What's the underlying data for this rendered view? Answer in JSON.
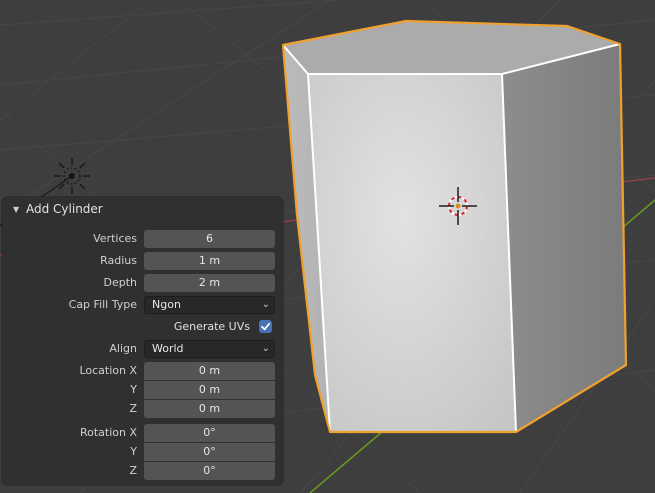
{
  "panel": {
    "title": "Add Cylinder",
    "vertices": {
      "label": "Vertices",
      "value": "6"
    },
    "radius": {
      "label": "Radius",
      "value": "1 m"
    },
    "depth": {
      "label": "Depth",
      "value": "2 m"
    },
    "cap_fill_type": {
      "label": "Cap Fill Type",
      "value": "Ngon"
    },
    "generate_uvs": {
      "label": "Generate UVs",
      "checked": true
    },
    "align": {
      "label": "Align",
      "value": "World"
    },
    "location": {
      "x": {
        "label": "Location X",
        "value": "0 m"
      },
      "y": {
        "label": "Y",
        "value": "0 m"
      },
      "z": {
        "label": "Z",
        "value": "0 m"
      }
    },
    "rotation": {
      "x": {
        "label": "Rotation X",
        "value": "0°"
      },
      "y": {
        "label": "Y",
        "value": "0°"
      },
      "z": {
        "label": "Z",
        "value": "0°"
      }
    }
  },
  "icons": {
    "collapse": "triangle-down-icon",
    "dropdown": "chevron-down-icon",
    "check": "check-icon",
    "light": "light-icon",
    "cursor": "3d-cursor-icon"
  },
  "colors": {
    "viewport_bg": "#3e3e3e",
    "grid": "#474747",
    "x_axis": "#a0404a",
    "y_axis": "#6b9a1f",
    "selection_outline": "#f0a030",
    "panel_bg": "#303030",
    "field_bg": "#545454",
    "checkbox": "#4772b3"
  }
}
